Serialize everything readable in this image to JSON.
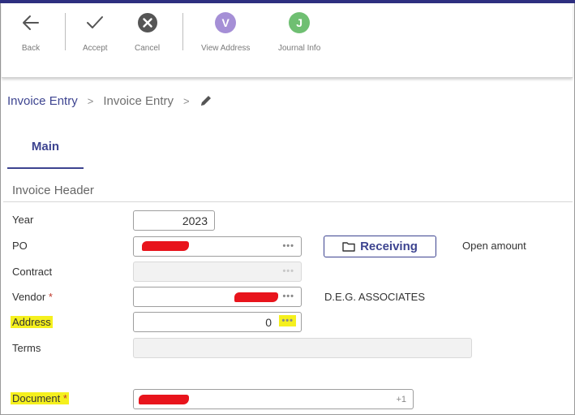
{
  "toolbar": {
    "back_label": "Back",
    "accept_label": "Accept",
    "cancel_label": "Cancel",
    "view_address_label": "View Address",
    "view_address_letter": "V",
    "journal_info_label": "Journal Info",
    "journal_info_letter": "J"
  },
  "breadcrumb": {
    "item1": "Invoice Entry",
    "item2": "Invoice Entry",
    "separator": ">"
  },
  "tabs": {
    "main": "Main"
  },
  "section": {
    "title": "Invoice Header"
  },
  "form": {
    "year_label": "Year",
    "year_value": "2023",
    "po_label": "PO",
    "contract_label": "Contract",
    "vendor_label": "Vendor",
    "vendor_name": "D.E.G. ASSOCIATES",
    "address_label": "Address",
    "address_value": "0",
    "terms_label": "Terms",
    "document_label": "Document",
    "document_suffix": "+1",
    "required_mark": "*",
    "lookup_glyph": "•••"
  },
  "receiving_button": {
    "label": "Receiving"
  },
  "open_amount_label": "Open amount",
  "colors": {
    "accent": "#3d4490",
    "view_address_circle": "#a58fd6",
    "journal_circle": "#6fbf72",
    "highlight": "#f5f01e",
    "redaction": "#e8141c"
  }
}
